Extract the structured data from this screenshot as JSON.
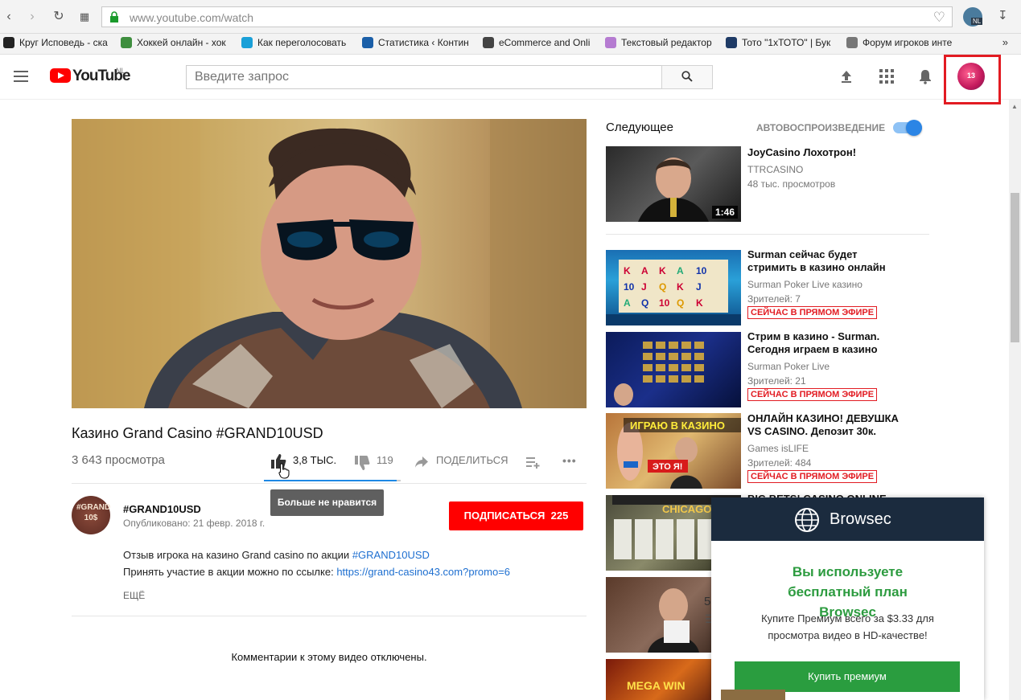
{
  "browser": {
    "url": "www.youtube.com/watch",
    "extension_badge": "NL",
    "bookmarks": [
      {
        "label": "Круг Исповедь - ска",
        "icon_color": "#222222"
      },
      {
        "label": "Хоккей онлайн - хок",
        "icon_color": "#3e8e3e"
      },
      {
        "label": "Как переголосовать",
        "icon_color": "#1aa0d8"
      },
      {
        "label": "Статистика ‹ Контин",
        "icon_color": "#1b5fa8"
      },
      {
        "label": "eCommerce and Onli",
        "icon_color": "#444444"
      },
      {
        "label": "Текстовый редактор",
        "icon_color": "#b57bd1"
      },
      {
        "label": "Тото \"1xТОТО\" | Бук",
        "icon_color": "#1f3b66"
      },
      {
        "label": "Форум игроков инте",
        "icon_color": "#777777"
      }
    ],
    "bookmarks_more": "»"
  },
  "masthead": {
    "logo_text": "YouTube",
    "region": "NL",
    "search_placeholder": "Введите запрос",
    "avatar_number": "13"
  },
  "video": {
    "title": "Казино Grand Casino #GRAND10USD",
    "views": "3 643 просмотра",
    "likes": "3,8 ТЫС.",
    "dislikes": "119",
    "share_label": "ПОДЕЛИТЬСЯ",
    "like_ratio": 0.97,
    "tooltip": "Больше не нравится",
    "more_icon": "•••"
  },
  "channel": {
    "name": "#GRAND10USD",
    "avatar_text": "#GRAND 10$",
    "published": "Опубликовано: 21 февр. 2018 г.",
    "subscribe_label": "ПОДПИСАТЬСЯ",
    "subscriber_count": "225"
  },
  "description": {
    "line1_text": "Отзыв игрока на казино Grand casino по акции ",
    "line1_link": "#GRAND10USD",
    "line2_text": "Принять участие в акции можно по ссылке: ",
    "line2_link": "https://grand-casino43.com?promo=6",
    "more_label": "ЕЩЁ"
  },
  "comments_notice": "Комментарии к этому видео отключены.",
  "sidebar": {
    "up_next": "Следующее",
    "autoplay_label": "АВТОВОСПРОИЗВЕДЕНИЕ",
    "autoplay_on": true,
    "videos": [
      {
        "title": "JoyCasino Лохотрон!",
        "channel": "TTRCASINO",
        "meta": "48 тыс. просмотров",
        "duration": "1:46",
        "live": ""
      },
      {
        "title": "Surman сейчас будет стримить в казино онлайн",
        "channel": "Surman Poker Live казино",
        "meta": "Зрителей: 7",
        "duration": "",
        "live": "СЕЙЧАС В ПРЯМОМ ЭФИРЕ"
      },
      {
        "title": "Стрим в казино - Surman. Сегодня играем в казино",
        "channel": "Surman Poker Live",
        "meta": "Зрителей: 21",
        "duration": "",
        "live": "СЕЙЧАС В ПРЯМОМ ЭФИРЕ"
      },
      {
        "title": "ОНЛАЙН КАЗИНО! ДЕВУШКА VS CASINO. Депозит 30к.",
        "channel": "Games isLIFE",
        "meta": "Зрителей: 484",
        "duration": "",
        "live": "СЕЙЧАС В ПРЯМОМ ЭФИРЕ"
      },
      {
        "title": "BIG BETS! CASINO ONLINE",
        "channel": "",
        "meta": "",
        "duration": "",
        "live": ""
      }
    ],
    "thumb_overlay_texts": [
      "ИГРАЮ В КАЗИНО",
      "ЭТО Я!",
      "CHICAGO",
      "MEGA WIN"
    ],
    "partial_number": "5"
  },
  "browsec": {
    "brand": "Browsec",
    "headline": "Вы используете бесплатный план Browsec",
    "body": "Купите Премиум всего за $3.33 для просмотра видео в HD-качестве!",
    "button": "Купить премиум"
  }
}
